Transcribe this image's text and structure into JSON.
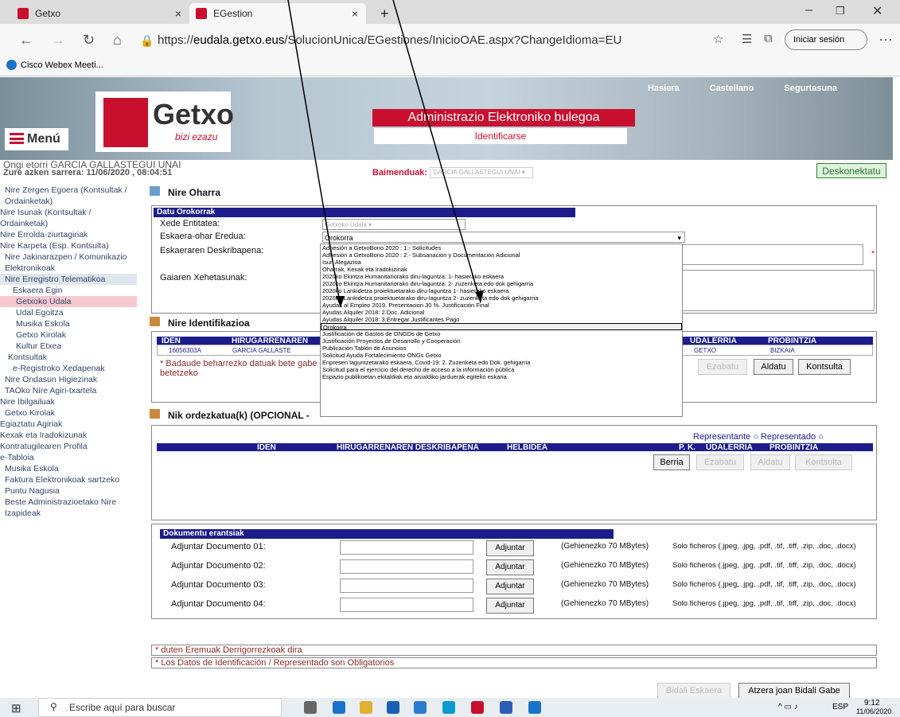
{
  "browser": {
    "tabs": [
      {
        "title": "Getxo"
      },
      {
        "title": "EGestion"
      }
    ],
    "url_prefix": "https://",
    "url_host": "eudala.getxo.eus",
    "url_path": "/SolucionUnica/EGestiones/InicioOAE.aspx?ChangeIdioma=EU",
    "sign_in": "Iniciar sesión",
    "bookmark": "Cisco Webex Meeti..."
  },
  "banner": {
    "links": [
      "Hasiera",
      "Castellano",
      "Segurtasuna"
    ],
    "logo_name": "Getxo",
    "logo_motto": "bizi ezazu",
    "menu": "Menú",
    "title": "Administrazio Elektroniko bulegoa",
    "identify": "Identificarse"
  },
  "user": {
    "welcome": "Ongi etorri GARCIA GALLASTEGUI UNAI",
    "last": "Zure azken sarrera: 11/06/2020 , 08:04:51",
    "baimen_label": "Baimenduak:",
    "baimen_value": "GARCIA GALLASTEGUI UNAI",
    "logout": "Deskonektatu"
  },
  "sidebar": [
    "Nire Zergen Egoera (Kontsultak / Ordainketak)",
    "Nire Isunak (Kontsultak / Ordainketak)",
    "Nire Errolda-ziurtagiriak",
    "Nire Karpeta (Esp. Kontsulta)",
    "Nire Jakinarazpen / Komunikazio Elektronikoak",
    "Nire Erregistro Telematikoa",
    "Eskaera Egin",
    "Getxoko Udala",
    "Udal Egoitza",
    "Musika Eskola",
    "Getxo Kirolak",
    "Kultur Etxea",
    "Kontsultak",
    "e-Registroko Xedapenak",
    "Nire Ondasun Higiezinak",
    "TAOko Nire Agiri-txartela",
    "Nire Ibilgailuak",
    "Getxo Kirolak",
    "Egiaztatu Agiriak",
    "Kexak eta Iradokizunak",
    "Kontratugilearen Profila",
    "e-Tabloia",
    "Musika Eskola",
    "Faktura Elektronikoak sartzeko Puntu Nagusia",
    "Beste Administrazioetako Nire Izapideak"
  ],
  "form": {
    "title": "Nire Oharra",
    "section": "Datu Orokorrak",
    "xede_label": "Xede Entitatea:",
    "xede_value": "Getxoko Udala",
    "eredua_label": "Eskaera-ohar Eredua:",
    "eredua_value": "Orokorra",
    "desk_label": "Eskaeraren Deskribapena:",
    "gaia_label": "Gaiaren Xehetasunak:"
  },
  "dropdown": [
    "Adhesión a GetxoBono 2020 : 1.- Solicitudes",
    "Adhesión a GetxoBono 2020 : 2.- Subsanación y Documentación Adicional",
    "Isun Alegazioa",
    "Oharrak, Kexak eta Iradokizinak",
    "2020ko Ekintza Humanitariorako diru-laguntza: 1- hasierako eskaera",
    "2020ko Ekintza Humanitariorako diru-laguntza: 2- zuzenketa edo dok gehigarria",
    "2020ko Lankidetza proiektuetarako diru-laguntza 1- hasierako eskaera",
    "2020ko Lankidetza proiektuetarako diru-laguntza 2- zuzenketa edo dok gehigarria",
    "Ayudas al Empleo 2019. Presentacion 30 %. Justificación Final",
    "Ayudas Alquiler 2018: 2.Doc. Adicional",
    "Ayudas Alquiler 2018: 3.Entregar Justificantes Pago",
    "Orokorra",
    "Justificación de Gastos de ONGDs de Getxo",
    "Justificación Proyectos de Desarrollo y Cooperación",
    "Publicación Tablón de Anuncios",
    "Solicitud Ayuda Fortalecimiento ONGs Getxo",
    "Enpresen laguntzetarako eskaera, Covid-19: 2. Zuzenketa edo Dok. gehigarria",
    "Solicitud para el ejercicio del derecho de acceso a la información pública",
    "Espazio publikoetan ekitaldiak eta aisialdiko jarduerak egiteko eskaria"
  ],
  "ident": {
    "title": "Nire Identifikazioa",
    "cols": [
      "IDEN",
      "HIRUGARRENAREN",
      "UDALERRIA",
      "PROBINTZIA"
    ],
    "row": {
      "iden": "16056303A",
      "name": "GARCIA GALLASTE",
      "udal": "GETXO",
      "prob": "BIZKAIA"
    },
    "note": "* Badaude beharrezko datuak bete gabe",
    "note2": "betetzeko",
    "buttons": [
      "Ezabatu",
      "Aldatu",
      "Kontsulta"
    ]
  },
  "repr": {
    "title": "Nik ordezkatua(k) (OPCIONAL - ",
    "rep": "Representante",
    "repd": "Representado",
    "cols": [
      "IDEN",
      "HIRUGARRENAREN DESKRIBAPENA",
      "HELBIDEA",
      "P. K.",
      "UDALERRIA",
      "PROBINTZIA"
    ],
    "buttons": [
      "Berria",
      "Ezabatu",
      "Aldatu",
      "Kontsulta"
    ]
  },
  "docs": {
    "title": "Dokumentu erantsiak",
    "rows": [
      "Adjuntar Documento 01:",
      "Adjuntar Documento 02:",
      "Adjuntar Documento 03:",
      "Adjuntar Documento 04:"
    ],
    "btn": "Adjuntar",
    "max": "(Gehienezko 70 MBytes)",
    "types": "Solo ficheros (.jpeg, .jpg, .pdf, .tif, .tiff, .zip, .doc, .docx)"
  },
  "footer": {
    "n1": "* duten Eremuak Derrigorrezkoak dira",
    "n2": "* Los Datos de Identificación / Representado son Obligatorios",
    "send": "Bidali Eskaera",
    "back": "Atzera joan Bidali Gabe"
  },
  "taskbar": {
    "search": "Escribe aquí para buscar",
    "lang": "ESP",
    "time": "9:12",
    "date": "11/06/2020"
  }
}
